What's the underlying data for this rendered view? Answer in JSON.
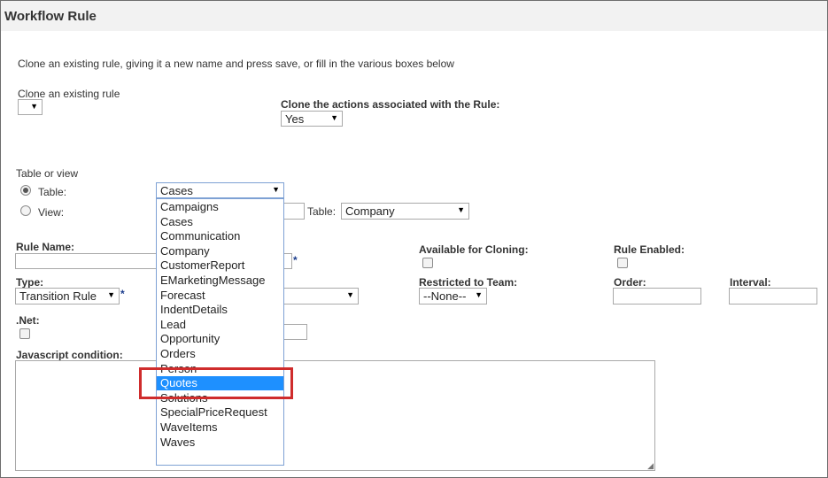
{
  "window": {
    "title": "Workflow Rule"
  },
  "intro_text": "Clone an existing rule, giving it a new name and press save, or fill in the various boxes below",
  "clone": {
    "label": "Clone an existing rule",
    "value": "",
    "actions_label": "Clone the actions associated with the Rule:",
    "actions_value": "Yes"
  },
  "table_or_view": {
    "label": "Table or view",
    "table_option": "Table:",
    "view_option": "View:",
    "table_value": "Cases",
    "view_table_label": "Table:",
    "view_table_value": "Company"
  },
  "rule": {
    "name_label": "Rule Name:",
    "available_label": "Available for Cloning:",
    "enabled_label": "Rule Enabled:",
    "type_label": "Type:",
    "type_value": "Transition Rule",
    "restricted_label": "Restricted to Team:",
    "restricted_value": "--None--",
    "order_label": "Order:",
    "interval_label": "Interval:",
    "net_label": ".Net:",
    "js_label": "Javascript condition:",
    "required_mark": "*"
  },
  "dropdown": {
    "items": [
      "Campaigns",
      "Cases",
      "Communication",
      "Company",
      "CustomerReport",
      "EMarketingMessage",
      "Forecast",
      "IndentDetails",
      "Lead",
      "Opportunity",
      "Orders",
      "Person",
      "Quotes",
      "Solutions",
      "SpecialPriceRequest",
      "WaveItems",
      "Waves"
    ],
    "selected": "Quotes"
  },
  "colors": {
    "selection": "#1e90ff",
    "highlight": "#cf2c2c",
    "focus_border": "#7ea1d4",
    "title_bar": "#f2f2f2"
  }
}
